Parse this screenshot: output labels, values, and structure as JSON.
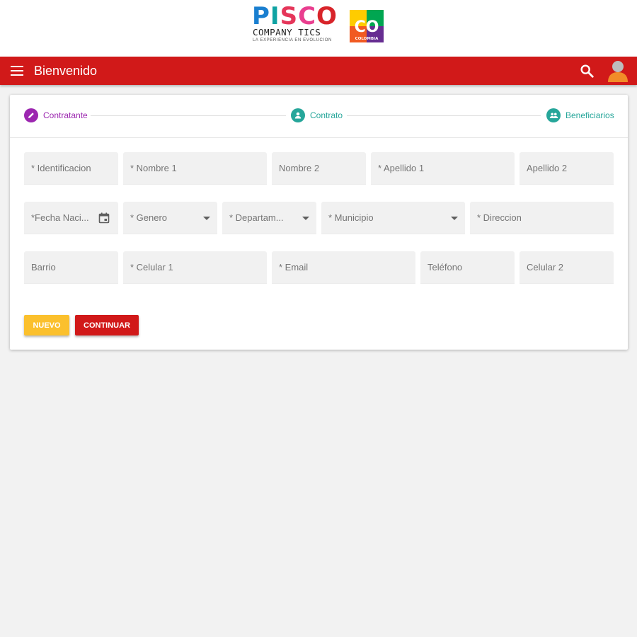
{
  "brand": {
    "letters": [
      "P",
      "I",
      "S",
      "C",
      "O"
    ],
    "letter_colors": [
      "#1a7fd0",
      "#0fa3a3",
      "#e5365a",
      "#e93e8f",
      "#d8242a"
    ],
    "subtitle": "COMPANY TICS",
    "tagline": "LA EXPERIENCIA EN EVOLUCION",
    "badge_text": "CO",
    "badge_subtext": "COLOMBIA"
  },
  "appbar": {
    "title": "Bienvenido",
    "color": "#d11919",
    "menu_icon": "menu-icon",
    "search_icon": "search-icon",
    "avatar_icon": "user-avatar-icon"
  },
  "stepper": {
    "steps": [
      {
        "label": "Contratante",
        "icon": "pencil-icon",
        "color": "#9c27b0"
      },
      {
        "label": "Contrato",
        "icon": "person-icon",
        "color": "#26a69a"
      },
      {
        "label": "Beneficiarios",
        "icon": "group-icon",
        "color": "#26a69a"
      }
    ]
  },
  "form": {
    "rows": [
      [
        {
          "placeholder": "* Identificacion",
          "type": "text"
        },
        {
          "placeholder": "* Nombre 1",
          "type": "text"
        },
        {
          "placeholder": "Nombre 2",
          "type": "text"
        },
        {
          "placeholder": "* Apellido 1",
          "type": "text"
        },
        {
          "placeholder": "Apellido 2",
          "type": "text"
        }
      ],
      [
        {
          "placeholder": "*Fecha Naci...",
          "type": "date",
          "icon": "calendar-icon"
        },
        {
          "placeholder": "* Genero",
          "type": "select"
        },
        {
          "placeholder": "* Departam...",
          "type": "select"
        },
        {
          "placeholder": "* Municipio",
          "type": "select"
        },
        {
          "placeholder": "* Direccion",
          "type": "text"
        }
      ],
      [
        {
          "placeholder": "Barrio",
          "type": "text"
        },
        {
          "placeholder": "* Celular 1",
          "type": "text"
        },
        {
          "placeholder": "* Email",
          "type": "text"
        },
        {
          "placeholder": "Teléfono",
          "type": "text"
        },
        {
          "placeholder": "Celular 2",
          "type": "text"
        }
      ]
    ]
  },
  "buttons": {
    "nuevo": {
      "label": "NUEVO",
      "color": "#fbc02d"
    },
    "continuar": {
      "label": "CONTINUAR",
      "color": "#d11919"
    }
  }
}
